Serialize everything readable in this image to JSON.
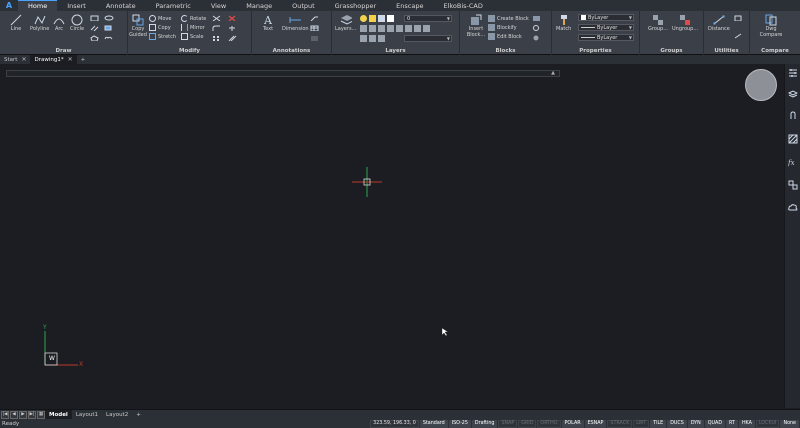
{
  "ribbon_tabs": [
    "Home",
    "Insert",
    "Annotate",
    "Parametric",
    "View",
    "Manage",
    "Output",
    "Grasshopper",
    "Enscape",
    "ElkoBis-CAD"
  ],
  "active_tab": "Home",
  "panels": {
    "draw": {
      "title": "Draw",
      "tools": [
        "Line",
        "Polyline",
        "Arc",
        "Circle"
      ]
    },
    "modify": {
      "title": "Modify",
      "copy_guided": "Copy\nGuided",
      "tools": [
        "Move",
        "Copy",
        "Stretch",
        "Rotate",
        "Mirror",
        "Scale"
      ]
    },
    "annotations": {
      "title": "Annotations",
      "tools": [
        "Text",
        "Dimension"
      ]
    },
    "layers": {
      "title": "Layers",
      "layers_button": "Layers...",
      "current_layer": "0"
    },
    "blocks": {
      "title": "Blocks",
      "insert": "Insert\nBlock...",
      "tools": [
        "Create Block",
        "Blockify",
        "Edit Block"
      ]
    },
    "properties": {
      "title": "Properties",
      "match": "Match",
      "color": "ByLayer",
      "linetype": "ByLayer",
      "lineweight": "ByLayer"
    },
    "groups": {
      "title": "Groups",
      "tools": [
        "Group...",
        "Ungroup..."
      ]
    },
    "utilities": {
      "title": "Utilities",
      "distance": "Distance"
    },
    "compare": {
      "title": "Compare",
      "dwg_compare": "Dwg\nCompare"
    }
  },
  "document_tabs": [
    {
      "label": "Start",
      "active": false
    },
    {
      "label": "Drawing1*",
      "active": true
    }
  ],
  "add_tab_symbol": "+",
  "layout_tabs": [
    "Model",
    "Layout1",
    "Layout2"
  ],
  "active_layout": "Model",
  "ucs": {
    "x_label": "X",
    "y_label": "Y",
    "w_label": "W"
  },
  "status": {
    "text": "Ready",
    "coords": "323.59, 196.33, 0",
    "toggles": [
      {
        "label": "Standard",
        "on": true
      },
      {
        "label": "ISO-25",
        "on": true
      },
      {
        "label": "Drafting",
        "on": true
      },
      {
        "label": "SNAP",
        "on": false
      },
      {
        "label": "GRID",
        "on": false
      },
      {
        "label": "ORTHO",
        "on": false
      },
      {
        "label": "POLAR",
        "on": true
      },
      {
        "label": "ESNAP",
        "on": true
      },
      {
        "label": "STRACK",
        "on": false
      },
      {
        "label": "LWT",
        "on": false
      },
      {
        "label": "TILE",
        "on": true
      },
      {
        "label": "DUCS",
        "on": true
      },
      {
        "label": "DYN",
        "on": true
      },
      {
        "label": "QUAD",
        "on": true
      },
      {
        "label": "RT",
        "on": true
      },
      {
        "label": "HKA",
        "on": true
      },
      {
        "label": "LOCKUI",
        "on": false
      },
      {
        "label": "None",
        "on": true
      }
    ]
  },
  "colors": {
    "accent": "#4aa3ff",
    "canvas": "#1b1d22",
    "ribbon": "#3a3f48",
    "crosshair": "#2ea44f"
  }
}
